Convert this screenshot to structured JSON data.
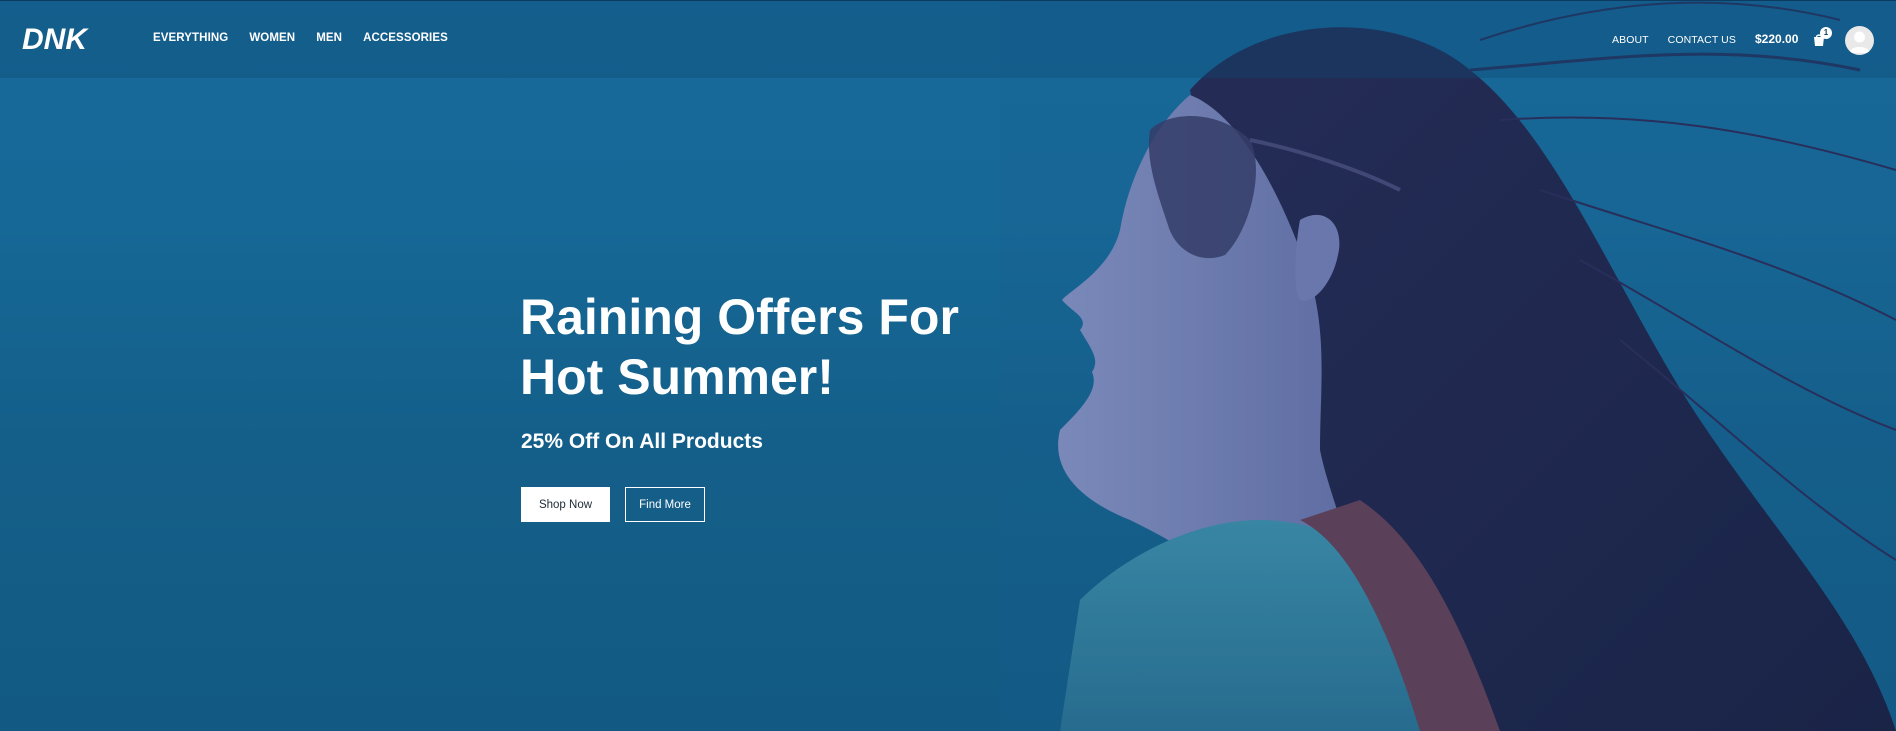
{
  "brand": {
    "logo_text": "DNK"
  },
  "nav": {
    "primary": [
      {
        "label": "EVERYTHING"
      },
      {
        "label": "WOMEN"
      },
      {
        "label": "MEN"
      },
      {
        "label": "ACCESSORIES"
      }
    ],
    "secondary": [
      {
        "label": "ABOUT"
      },
      {
        "label": "CONTACT US"
      }
    ]
  },
  "cart": {
    "total": "$220.00",
    "count": "1",
    "icon": "shopping-bag-icon"
  },
  "account": {
    "icon": "user-avatar-icon"
  },
  "hero": {
    "headline": "Raining Offers For Hot Summer!",
    "subheadline": "25% Off On All Products",
    "primary_button": "Shop Now",
    "secondary_button": "Find More"
  },
  "colors": {
    "background": "#176a9b",
    "text": "#ffffff",
    "button_fill": "#ffffff",
    "button_text": "#1e2b36"
  }
}
